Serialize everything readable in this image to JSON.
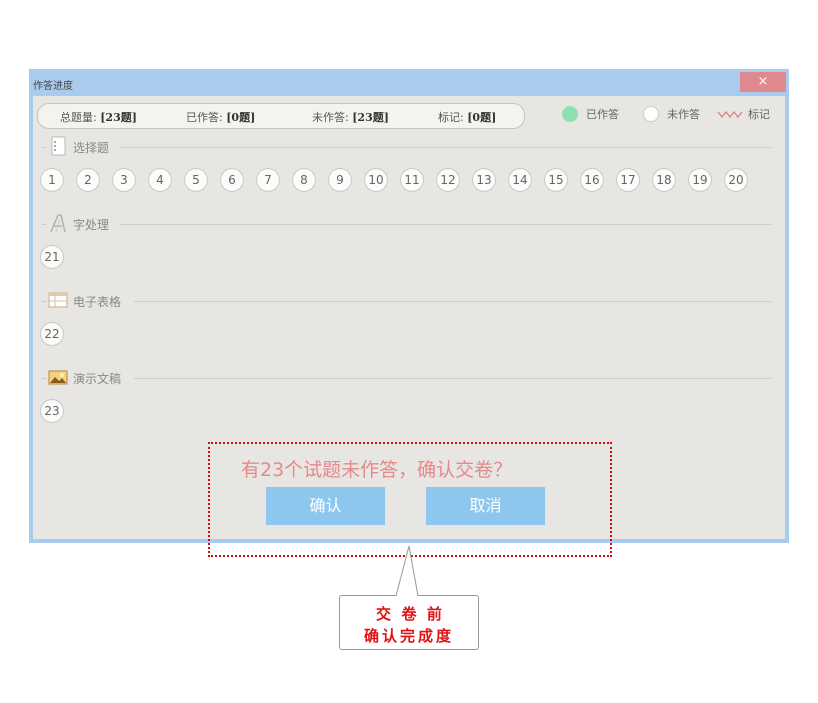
{
  "window": {
    "title": "作答进度",
    "close_glyph": "×"
  },
  "summary": {
    "total_label": "总题量:",
    "total_value": "[23题]",
    "answered_label": "已作答:",
    "answered_value": "[0题]",
    "unanswered_label": "未作答:",
    "unanswered_value": "[23题]",
    "marked_label": "标记:",
    "marked_value": "[0题]"
  },
  "legend": {
    "answered": "已作答",
    "unanswered": "未作答",
    "marked": "标记",
    "answered_color": "#8fe0b0",
    "marked_color": "#e07a7a"
  },
  "sections": [
    {
      "label": "选择题",
      "icon": "document-list-icon",
      "questions": [
        "1",
        "2",
        "3",
        "4",
        "5",
        "6",
        "7",
        "8",
        "9",
        "10",
        "11",
        "12",
        "13",
        "14",
        "15",
        "16",
        "17",
        "18",
        "19",
        "20"
      ]
    },
    {
      "label": "字处理",
      "icon": "letter-a-icon",
      "questions": [
        "21"
      ]
    },
    {
      "label": "电子表格",
      "icon": "spreadsheet-icon",
      "questions": [
        "22"
      ]
    },
    {
      "label": "演示文稿",
      "icon": "presentation-icon",
      "questions": [
        "23"
      ]
    }
  ],
  "confirm": {
    "message": "有23个试题未作答，确认交卷？",
    "ok_label": "确认",
    "cancel_label": "取消"
  },
  "callout": {
    "line1": "交  卷  前",
    "line2": "确认完成度"
  }
}
